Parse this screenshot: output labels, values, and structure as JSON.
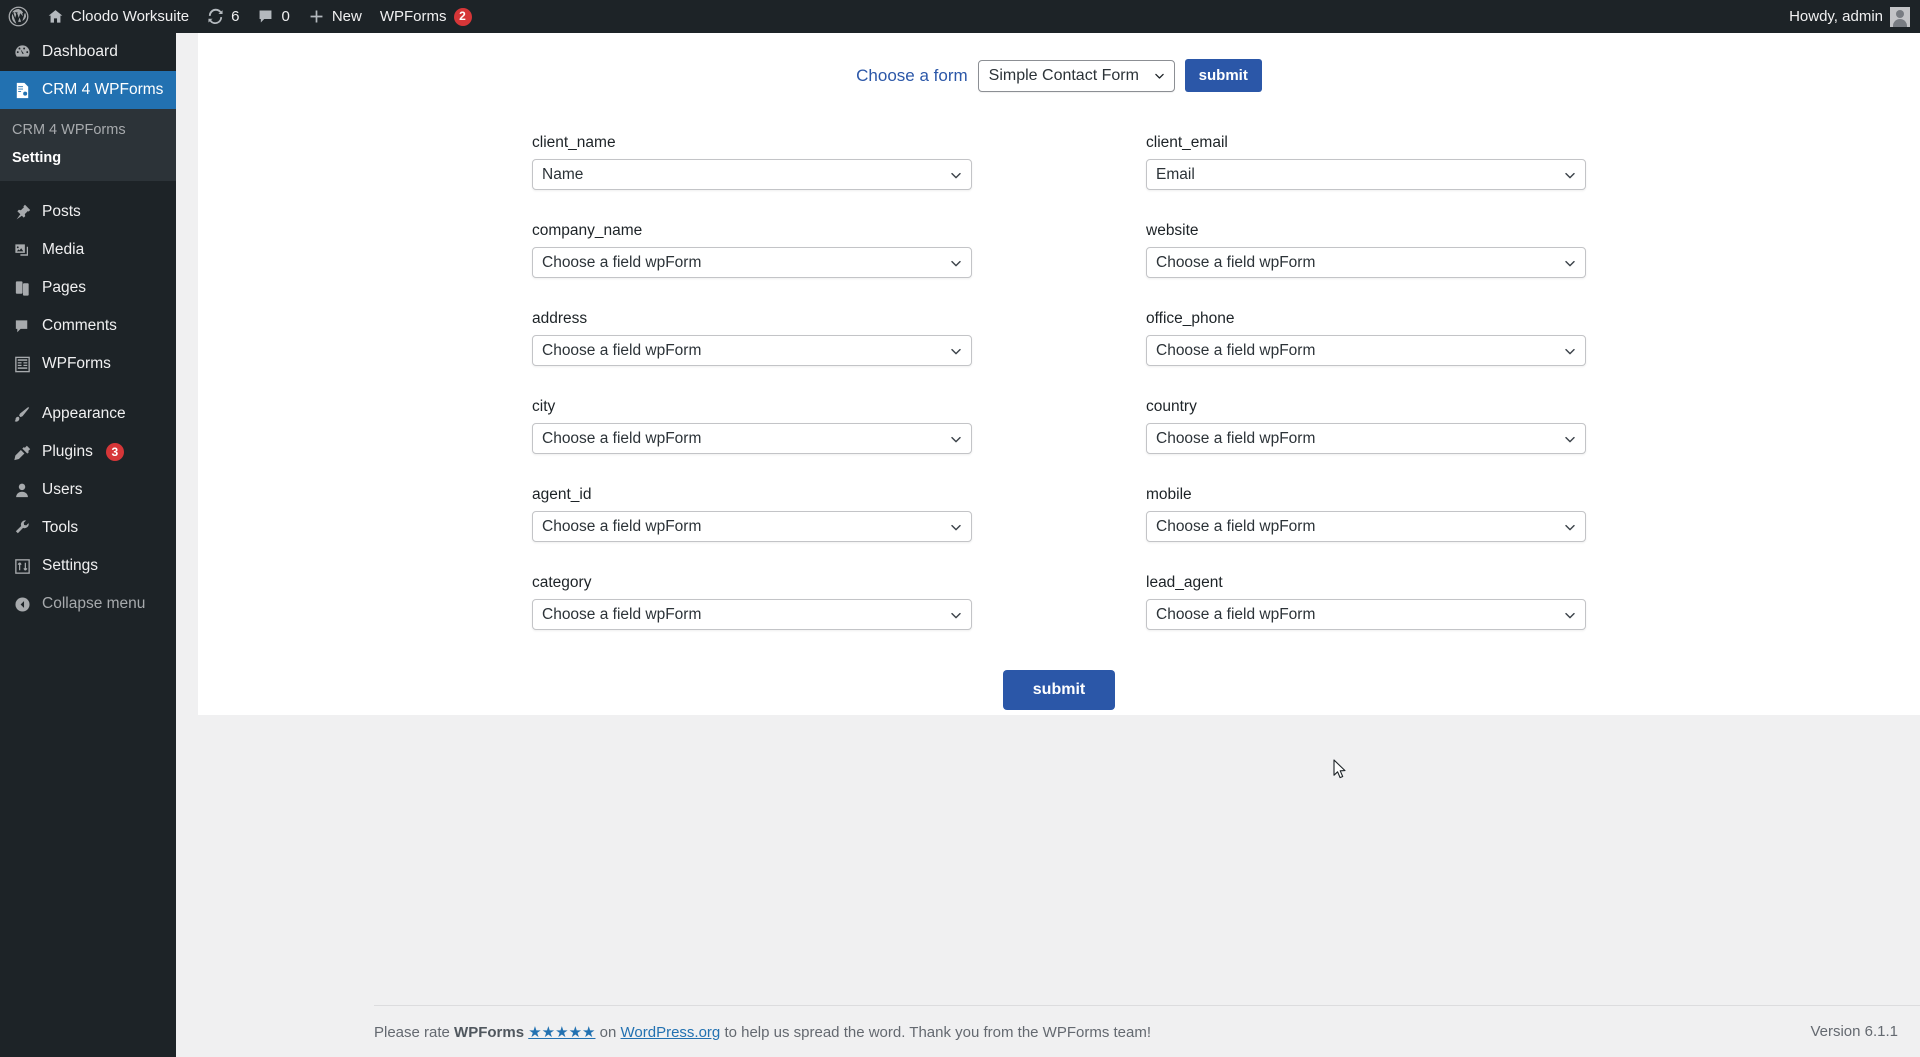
{
  "adminbar": {
    "logo_icon": "wordpress-logo-icon",
    "site_icon": "home-icon",
    "site_name": "Cloodo Worksuite",
    "updates_icon": "updates-icon",
    "updates_count": "6",
    "comments_icon": "comment-bubble-icon",
    "comments_count": "0",
    "new_icon": "plus-icon",
    "new_label": "New",
    "wpforms_label": "WPForms",
    "wpforms_badge": "2",
    "howdy": "Howdy, admin",
    "avatar_icon": "avatar-icon"
  },
  "sidebar": {
    "items": [
      {
        "label": "Dashboard",
        "icon": "dashboard-icon"
      },
      {
        "label": "CRM 4 WPForms",
        "icon": "crm-page-icon",
        "current": true
      },
      {
        "label": "Posts",
        "icon": "pin-icon"
      },
      {
        "label": "Media",
        "icon": "media-icon"
      },
      {
        "label": "Pages",
        "icon": "pages-icon"
      },
      {
        "label": "Comments",
        "icon": "comment-bubble-icon"
      },
      {
        "label": "WPForms",
        "icon": "wpforms-icon"
      },
      {
        "label": "Appearance",
        "icon": "paintbrush-icon"
      },
      {
        "label": "Plugins",
        "icon": "plug-icon",
        "badge": "3"
      },
      {
        "label": "Users",
        "icon": "user-icon"
      },
      {
        "label": "Tools",
        "icon": "wrench-icon"
      },
      {
        "label": "Settings",
        "icon": "sliders-icon"
      },
      {
        "label": "Collapse menu",
        "icon": "collapse-arrow-icon"
      }
    ],
    "submenu": [
      {
        "label": "CRM 4 WPForms",
        "current": false
      },
      {
        "label": "Setting",
        "current": true
      }
    ]
  },
  "chooser": {
    "label": "Choose a form",
    "selected_form": "Simple Contact Form",
    "submit_label": "submit",
    "chevron_icon": "chevron-down-icon"
  },
  "mapping": {
    "placeholder": "Choose a field wpForm",
    "chevron_icon": "chevron-down-icon",
    "fields": [
      {
        "name": "client_name",
        "value": "Name"
      },
      {
        "name": "client_email",
        "value": "Email"
      },
      {
        "name": "company_name",
        "value": "Choose a field wpForm"
      },
      {
        "name": "website",
        "value": "Choose a field wpForm"
      },
      {
        "name": "address",
        "value": "Choose a field wpForm"
      },
      {
        "name": "office_phone",
        "value": "Choose a field wpForm"
      },
      {
        "name": "city",
        "value": "Choose a field wpForm"
      },
      {
        "name": "country",
        "value": "Choose a field wpForm"
      },
      {
        "name": "agent_id",
        "value": "Choose a field wpForm"
      },
      {
        "name": "mobile",
        "value": "Choose a field wpForm"
      },
      {
        "name": "category",
        "value": "Choose a field wpForm"
      },
      {
        "name": "lead_agent",
        "value": "Choose a field wpForm"
      }
    ],
    "submit_label": "submit"
  },
  "footer": {
    "text_before": "Please rate ",
    "brand": "WPForms",
    "stars": "★★★★★",
    "text_mid": " on ",
    "link": "WordPress.org",
    "text_after": " to help us spread the word. Thank you from the WPForms team!",
    "version": "Version 6.1.1"
  },
  "colors": {
    "admin_dark": "#1d2327",
    "submenu_dark": "#2c3338",
    "accent_blue": "#2271b1",
    "button_blue": "#2b57a8",
    "badge_red": "#d63638",
    "page_bg": "#f0f0f1"
  }
}
